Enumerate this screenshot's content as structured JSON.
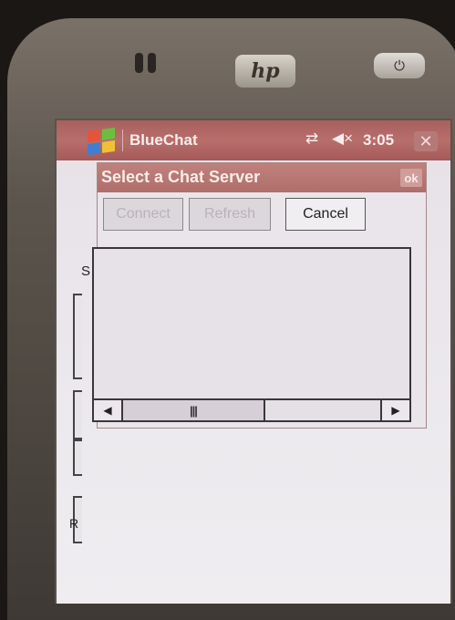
{
  "device": {
    "brand_logo": "hp",
    "power_glyph": "⏻"
  },
  "titlebar": {
    "start_icon": "windows-flag-icon",
    "app_title": "BlueChat",
    "connectivity_icon": "connectivity-icon",
    "connectivity_glyph": "⇄",
    "volume_icon": "volume-muted-icon",
    "volume_glyph": "◀×",
    "clock": "3:05",
    "close_glyph": "✕"
  },
  "background_form": {
    "label_fragment": "S",
    "label_fragment_2": "R"
  },
  "dialog": {
    "title": "Select a Chat Server",
    "ok_label": "ok",
    "buttons": [
      {
        "label": "Connect",
        "enabled": false
      },
      {
        "label": "Refresh",
        "enabled": false
      },
      {
        "label": "Cancel",
        "enabled": true
      }
    ],
    "server_list": {
      "items": [],
      "scroll_left_glyph": "◀",
      "scroll_right_glyph": "▶",
      "thumb_grip": "|||"
    }
  },
  "colors": {
    "titlebar": "#b06b69",
    "dialog_title": "#b8766f",
    "screen_bg": "#ece9ee"
  }
}
